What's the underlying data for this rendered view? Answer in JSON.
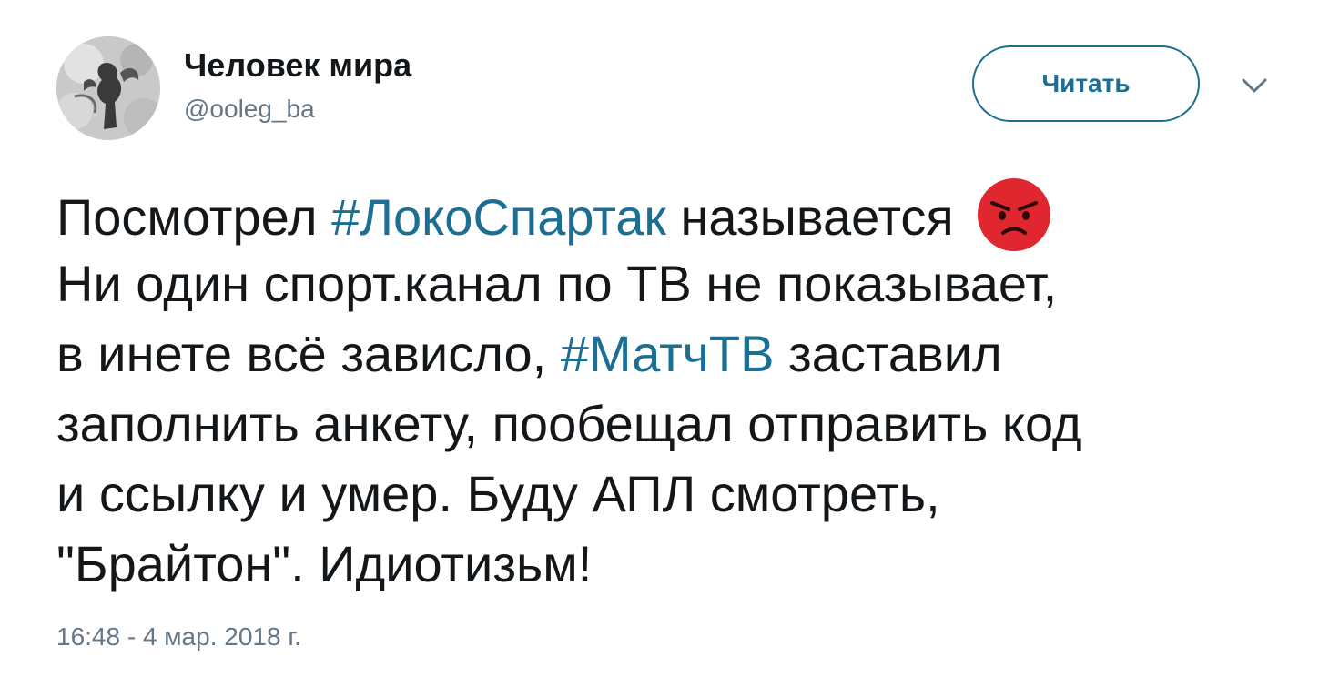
{
  "author": {
    "display_name": "Человек мира",
    "handle": "@ooleg_ba"
  },
  "follow_button": {
    "label": "Читать"
  },
  "menu": {
    "icon": "chevron-down-icon"
  },
  "tweet": {
    "line1_pre": "Посмотрел ",
    "hashtag1": "#ЛокоСпартак",
    "line1_post": " называется",
    "emoji": "angry-face-icon",
    "line2": "Ни один спорт.канал по ТВ не показывает,",
    "line3_pre": "в инете всё зависло, ",
    "hashtag2": "#МатчТВ",
    "line3_post": " заставил",
    "line4": "заполнить анкету, пообещал отправить код",
    "line5": "и ссылку и умер. Буду АПЛ смотреть,",
    "line6": "\"Брайтон\". Идиотизьм!"
  },
  "timestamp": "16:48 - 4 мар. 2018 г.",
  "colors": {
    "text": "#14171a",
    "secondary": "#657786",
    "link": "#1b6e94",
    "emoji_red": "#e0262f"
  }
}
